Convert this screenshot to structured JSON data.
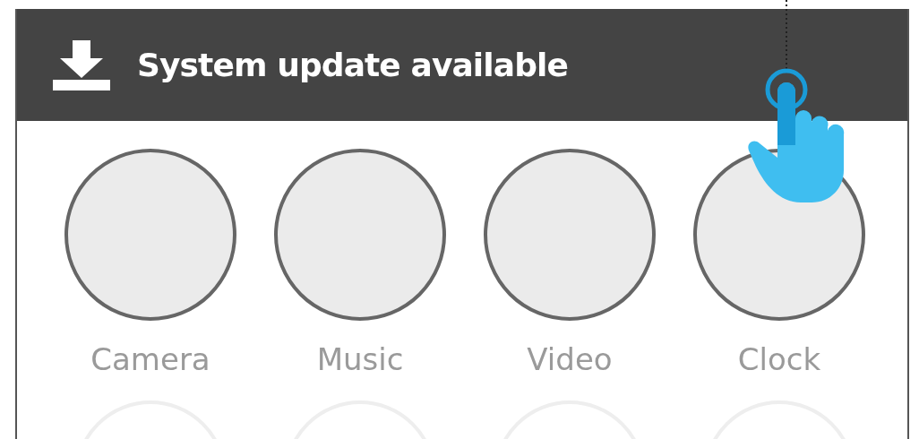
{
  "notification": {
    "title": "System update available"
  },
  "apps": [
    {
      "label": "Camera"
    },
    {
      "label": "Music"
    },
    {
      "label": "Video"
    },
    {
      "label": "Clock"
    }
  ]
}
